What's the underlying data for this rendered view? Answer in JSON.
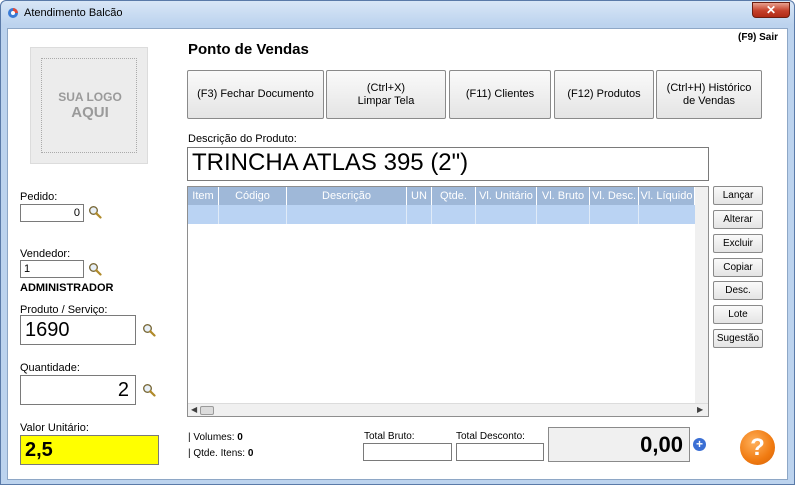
{
  "window": {
    "title": "Atendimento Balcão",
    "close_label": "✕"
  },
  "logo": {
    "line1": "SUA LOGO",
    "line2": "AQUI"
  },
  "header": {
    "title": "Ponto de Vendas",
    "exit_label": "(F9) Sair"
  },
  "function_buttons": [
    {
      "label": "(F3) Fechar Documento"
    },
    {
      "label": "(Ctrl+X)\nLimpar Tela"
    },
    {
      "label": "(F11) Clientes"
    },
    {
      "label": "(F12) Produtos"
    },
    {
      "label": "(Ctrl+H) Histórico\nde Vendas"
    }
  ],
  "left_panel": {
    "pedido_label": "Pedido:",
    "pedido_value": "0",
    "vendedor_label": "Vendedor:",
    "vendedor_value": "1",
    "vendedor_name": "ADMINISTRADOR",
    "produto_label": "Produto / Serviço:",
    "produto_value": "1690",
    "quantidade_label": "Quantidade:",
    "quantidade_value": "2",
    "valor_label": "Valor Unitário:",
    "valor_value": "2,5",
    "highlight_color": "#ffff00"
  },
  "product": {
    "description_label": "Descrição do Produto:",
    "description_value": "TRINCHA ATLAS 395 (2\")"
  },
  "grid": {
    "columns": [
      "Item",
      "Código",
      "Descrição",
      "UN",
      "Qtde.",
      "Vl. Unitário",
      "Vl. Bruto",
      "Vl. Desc.",
      "Vl. Líquido"
    ],
    "header_color": "#9fb8d8",
    "selected_row_color": "#bad3f3"
  },
  "side_buttons": [
    {
      "label": "Lançar"
    },
    {
      "label": "Alterar"
    },
    {
      "label": "Excluir"
    },
    {
      "label": "Copiar"
    },
    {
      "label": "Desc."
    },
    {
      "label": "Lote"
    },
    {
      "label": "Sugestão"
    }
  ],
  "footer": {
    "volumes_label": "| Volumes:",
    "volumes_value": "0",
    "itens_label": "| Qtde. Itens:",
    "itens_value": "0",
    "total_bruto_label": "Total Bruto:",
    "total_desconto_label": "Total Desconto:",
    "total_value": "0,00",
    "plus_icon": "plus-circle-icon",
    "help_icon": "help-icon",
    "help_glyph": "?",
    "plus_glyph": "+"
  }
}
